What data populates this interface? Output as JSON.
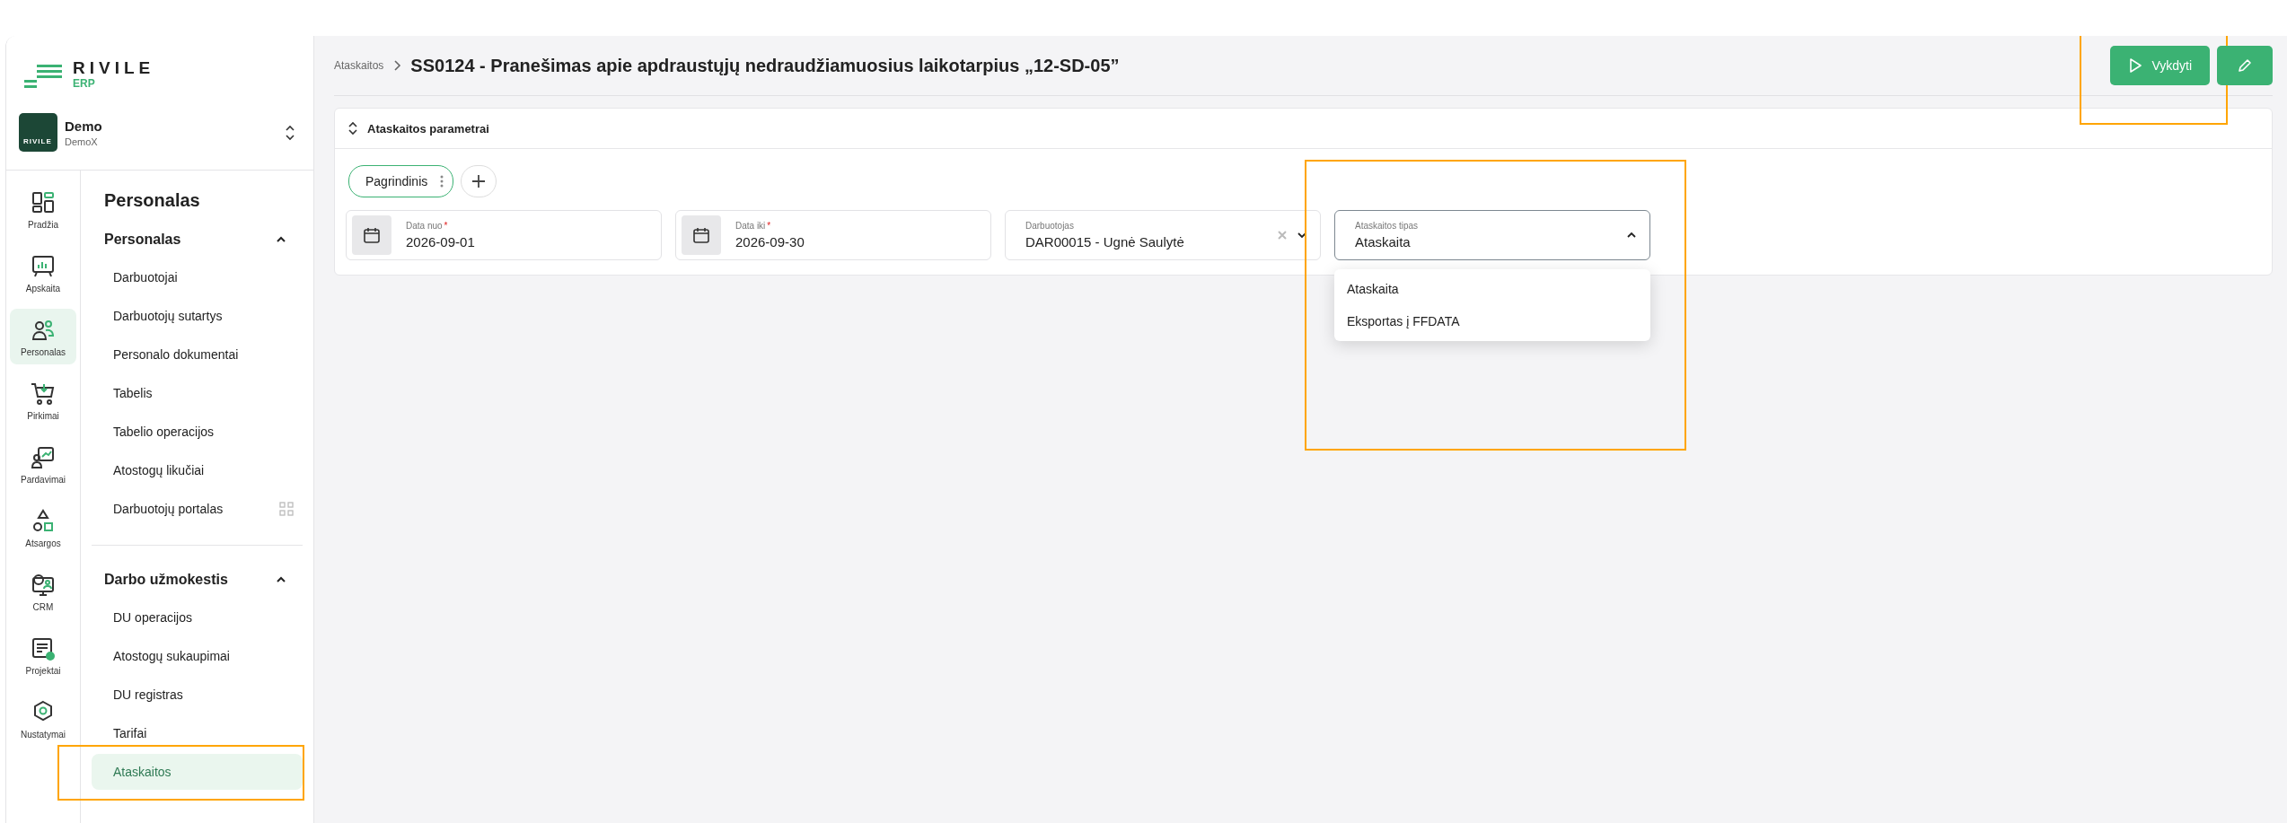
{
  "logo": {
    "wordmark": "RIVILE",
    "sub": "ERP"
  },
  "company": {
    "name": "Demo",
    "subtitle": "DemoX",
    "badge_text": "RIVILE"
  },
  "rail": [
    {
      "kind": "dashboard",
      "label": "Pradžia",
      "selected": false
    },
    {
      "kind": "accounting",
      "label": "Apskaita",
      "selected": false
    },
    {
      "kind": "people",
      "label": "Personalas",
      "selected": true
    },
    {
      "kind": "cart",
      "label": "Pirkimai",
      "selected": false
    },
    {
      "kind": "sales",
      "label": "Pardavimai",
      "selected": false
    },
    {
      "kind": "shapes",
      "label": "Atsargos",
      "selected": false
    },
    {
      "kind": "crm",
      "label": "CRM",
      "selected": false
    },
    {
      "kind": "projects",
      "label": "Projektai",
      "selected": false
    },
    {
      "kind": "settings",
      "label": "Nustatymai",
      "selected": false
    }
  ],
  "nav": {
    "title": "Personalas",
    "sections": [
      {
        "title": "Personalas",
        "expanded": true,
        "items": [
          {
            "label": "Darbuotojai",
            "selected": false
          },
          {
            "label": "Darbuotojų sutartys",
            "selected": false
          },
          {
            "label": "Personalo dokumentai",
            "selected": false
          },
          {
            "label": "Tabelis",
            "selected": false
          },
          {
            "label": "Tabelio operacijos",
            "selected": false
          },
          {
            "label": "Atostogų likučiai",
            "selected": false
          },
          {
            "label": "Darbuotojų portalas",
            "selected": false,
            "apps_icon": true
          }
        ]
      },
      {
        "title": "Darbo užmokestis",
        "expanded": true,
        "items": [
          {
            "label": "DU operacijos",
            "selected": false
          },
          {
            "label": "Atostogų sukaupimai",
            "selected": false
          },
          {
            "label": "DU registras",
            "selected": false
          },
          {
            "label": "Tarifai",
            "selected": false
          },
          {
            "label": "Ataskaitos",
            "selected": true,
            "highlighted": true
          }
        ]
      }
    ]
  },
  "breadcrumb": [
    "Ataskaitos"
  ],
  "title": "SS0124 - Pranešimas apie apdraustųjų nedraudžiamuosius laikotarpius „12-SD-05”",
  "actions": [
    {
      "kind": "run",
      "label": "Vykdyti",
      "highlighted": true
    },
    {
      "kind": "edit"
    }
  ],
  "panel": {
    "title": "Ataskaitos parametrai",
    "presets": [
      {
        "label": "Pagrindinis",
        "selected": true
      }
    ],
    "fields": [
      {
        "kind": "date",
        "label": "Data nuo",
        "required_mark": "*",
        "value": "2026-09-01"
      },
      {
        "kind": "date",
        "label": "Data iki",
        "required_mark": "*",
        "value": "2026-09-30"
      },
      {
        "kind": "select",
        "label": "Darbuotojas",
        "value": "DAR00015 - Ugnė Saulytė",
        "clearable": true,
        "open": false
      },
      {
        "kind": "select",
        "label": "Ataskaitos tipas",
        "value": "Ataskaita",
        "open": true,
        "highlighted": true,
        "options": [
          "Ataskaita",
          "Eksportas į FFDATA"
        ]
      }
    ]
  }
}
